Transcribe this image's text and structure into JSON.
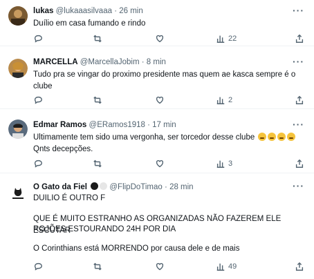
{
  "tweets": [
    {
      "name": "lukas",
      "handle": "@lukaaasilvaaa",
      "time": "26 min",
      "text": "Duílio em casa fumando e rindo",
      "likes": "",
      "views": "22",
      "more": "···"
    },
    {
      "name": "MARCELLA",
      "handle": "@MarcellaJobim",
      "time": "8 min",
      "text": "Tudo pra se vingar do proximo presidente mas quem ae kasca sempre é o clube",
      "views": "2",
      "more": "···"
    },
    {
      "name": "Edmar Ramos",
      "handle": "@ERamos1918",
      "time": "17 min",
      "text_line1": "Ultimamente tem sido uma vergonha, ser torcedor desse clube",
      "text_line2": "Qnts decepções.",
      "views": "3",
      "more": "···"
    },
    {
      "name": "O Gato da Fiel",
      "handle": "@FlipDoTimao",
      "time": "28 min",
      "line1": "DUILIO É OUTRO F",
      "line2": "QUE É MUITO ESTRANHO AS ORGANIZADAS NÃO FAZEREM ELE ESCUTAR",
      "line3": "ROJÕES ESTOURANDO 24H POR DIA",
      "line4": "O Corinthians está MORRENDO por causa dele e de mais",
      "views": "49",
      "more": "···"
    }
  ],
  "separator": "·",
  "colors": {
    "text": "#0f1419",
    "secondary": "#536471",
    "divider": "#eff3f4"
  }
}
